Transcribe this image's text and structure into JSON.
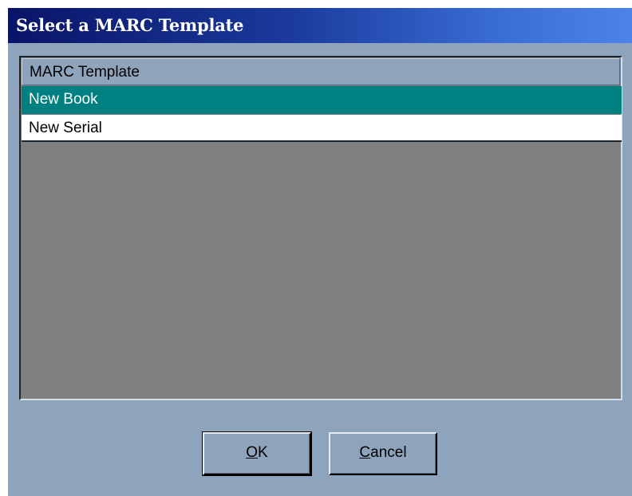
{
  "window": {
    "title": "Select a MARC Template"
  },
  "list": {
    "column_header": "MARC Template",
    "items": [
      {
        "label": "New Book",
        "selected": true
      },
      {
        "label": "New Serial",
        "selected": false
      }
    ]
  },
  "buttons": {
    "ok": {
      "accel": "O",
      "rest": "K"
    },
    "cancel": {
      "accel": "C",
      "rest": "ancel"
    }
  },
  "colors": {
    "dialog_background": "#8ea4bc",
    "title_bar_start": "#0a1468",
    "title_bar_end": "#4d83e8",
    "selection_highlight": "#008080",
    "list_empty_area": "#808080"
  }
}
